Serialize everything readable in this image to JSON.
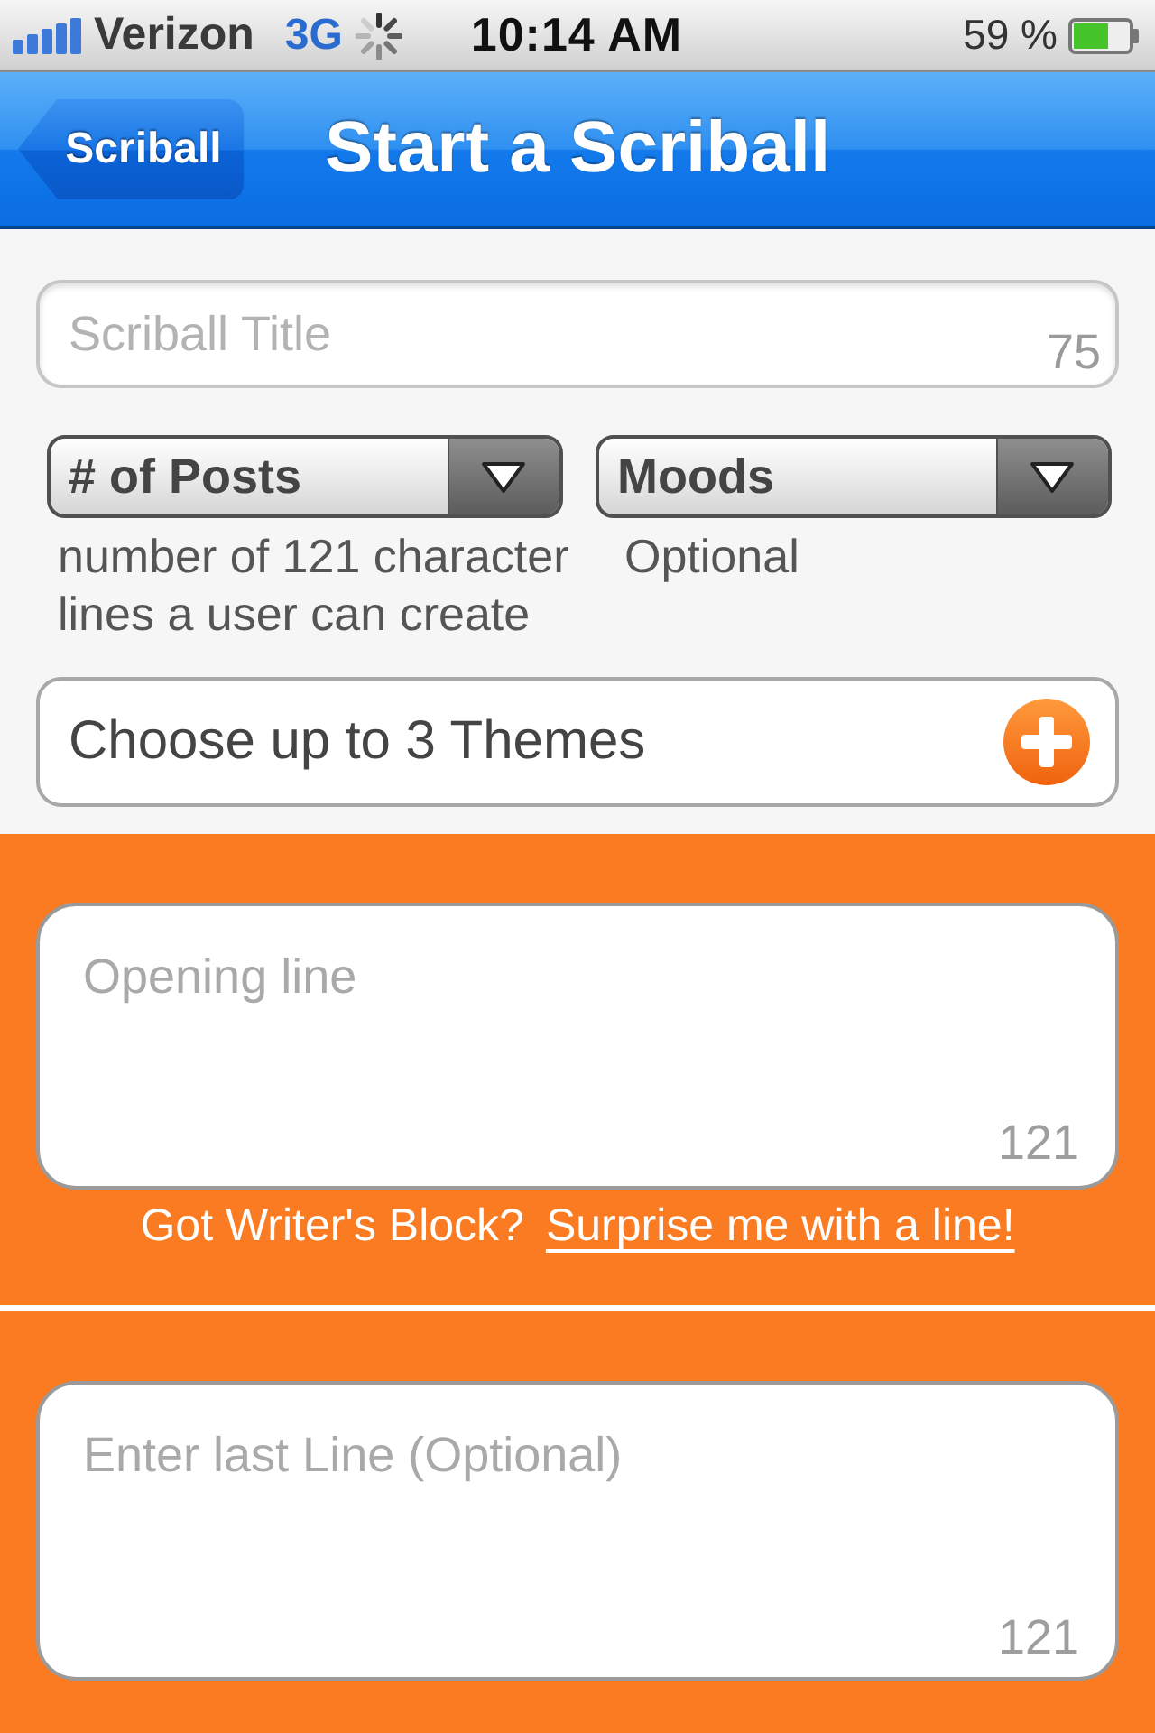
{
  "status_bar": {
    "carrier": "Verizon",
    "network": "3G",
    "time": "10:14 AM",
    "battery": "59 %"
  },
  "nav_bar": {
    "back_button": "Scriball",
    "title": "Start a Scriball"
  },
  "title_field": {
    "placeholder": "Scriball Title",
    "counter": "75"
  },
  "dropdowns": [
    {
      "label": "# of Posts",
      "hint": "number of 121 character lines a user can create"
    },
    {
      "label": "Moods",
      "hint": "Optional"
    }
  ],
  "themes": {
    "label": "Choose up to 3 Themes"
  },
  "opening_line": {
    "placeholder": "Opening line",
    "counter": "121",
    "prompt": "Got Writer's Block?",
    "link": "Surprise me with a line!"
  },
  "last_line": {
    "placeholder": "Enter last Line (Optional)",
    "counter": "121"
  }
}
